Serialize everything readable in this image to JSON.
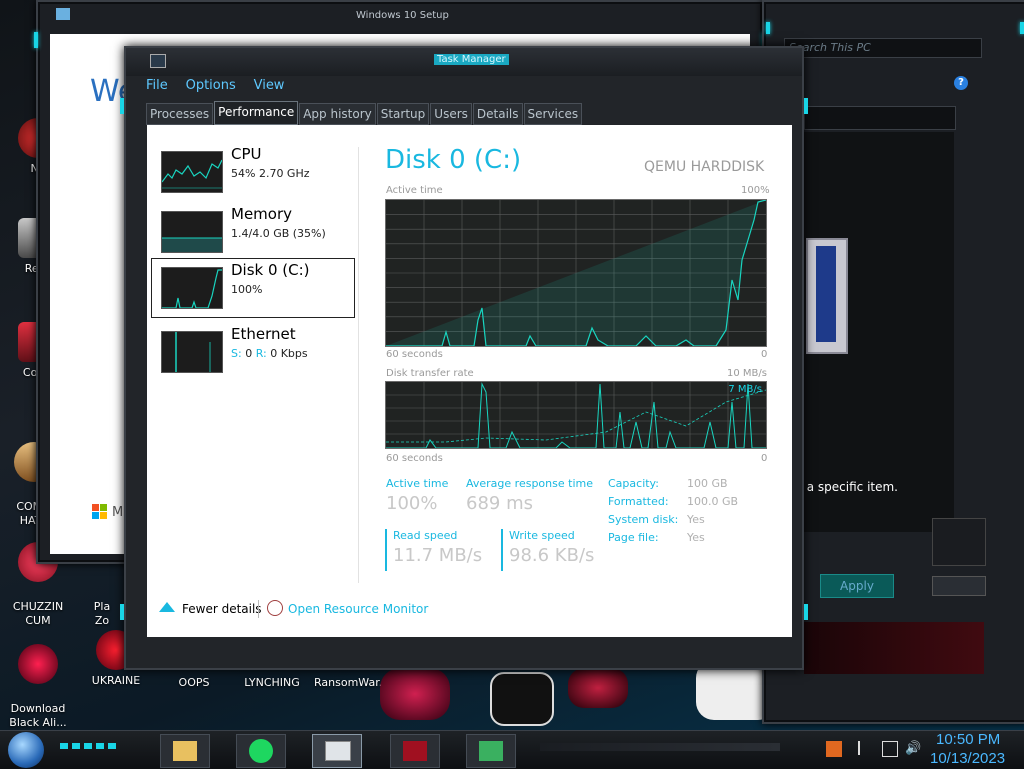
{
  "desktop": {
    "icons": [
      {
        "label": "Ne"
      },
      {
        "label": "Recy"
      },
      {
        "label": "Contr"
      },
      {
        "label": "COMM\nHATE"
      },
      {
        "label": "CHUZZIN\nCUM"
      },
      {
        "label": "Pla\nZo"
      },
      {
        "label": "Download\nBlack Ali..."
      },
      {
        "label": "UKRAINE"
      },
      {
        "label": "OOPS"
      },
      {
        "label": "LYNCHING"
      },
      {
        "label": "RansomWar..."
      }
    ],
    "setup_window_title": "Windows 10 Setup",
    "setup_window_text": "We",
    "setup_ms_text": "Mic",
    "explorer_search": "Search This PC",
    "background_text": "r a specific item.",
    "background_apply": "Apply"
  },
  "task_manager": {
    "title": "Task Manager",
    "menu": [
      "File",
      "Options",
      "View"
    ],
    "tabs": [
      "Processes",
      "Performance",
      "App history",
      "Startup",
      "Users",
      "Details",
      "Services"
    ],
    "active_tab": "Performance",
    "sidebar": [
      {
        "name": "CPU",
        "sub": "54%  2.70 GHz"
      },
      {
        "name": "Memory",
        "sub": "1.4/4.0 GB (35%)"
      },
      {
        "name": "Disk 0 (C:)",
        "sub": "100%"
      },
      {
        "name": "Ethernet",
        "sub_s": "S:",
        "sub_s_val": "0",
        "sub_r": "R:",
        "sub_r_val": "0 Kbps"
      }
    ],
    "detail": {
      "title": "Disk 0 (C:)",
      "model": "QEMU HARDDISK",
      "graph1_label": "Active time",
      "graph1_max": "100%",
      "graph1_time": "60 seconds",
      "graph1_min": "0",
      "graph2_label": "Disk transfer rate",
      "graph2_max": "10 MB/s",
      "graph2_inner": "7 MB/s",
      "graph2_time": "60 seconds",
      "graph2_min": "0",
      "active_time_label": "Active time",
      "active_time_value": "100%",
      "avg_resp_label": "Average response time",
      "avg_resp_value": "689 ms",
      "read_label": "Read speed",
      "read_value": "11.7 MB/s",
      "write_label": "Write speed",
      "write_value": "98.6 KB/s",
      "props": [
        {
          "label": "Capacity:",
          "value": "100 GB"
        },
        {
          "label": "Formatted:",
          "value": "100.0 GB"
        },
        {
          "label": "System disk:",
          "value": "Yes"
        },
        {
          "label": "Page file:",
          "value": "Yes"
        }
      ]
    },
    "footer": {
      "fewer_details": "Fewer details",
      "open_resource_monitor": "Open Resource Monitor"
    },
    "colors": {
      "accent": "#19b8e0",
      "graph_bg": "#202322",
      "graph_line": "#19d5c0"
    }
  },
  "taskbar": {
    "time": "10:50 PM",
    "date": "10/13/2023"
  }
}
